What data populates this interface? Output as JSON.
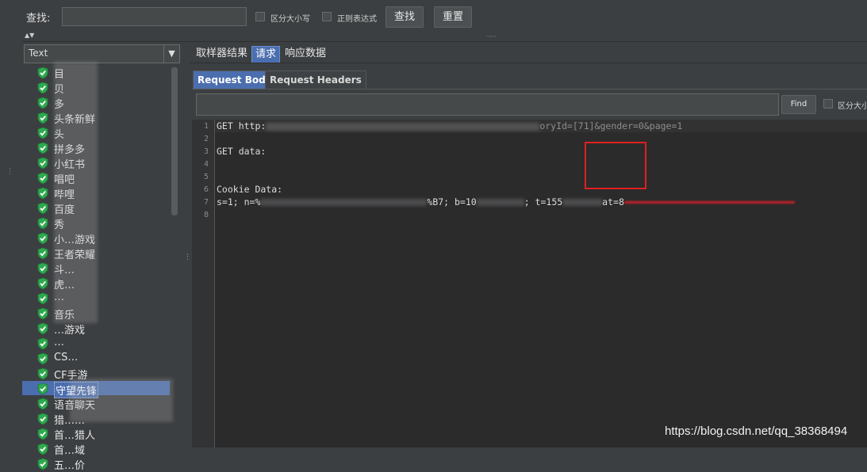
{
  "search": {
    "label": "查找:",
    "value": "",
    "case_label": "区分大小写",
    "regex_label": "正则表达式",
    "find_button": "查找",
    "reset_button": "重置"
  },
  "tree": {
    "combo_value": "Text",
    "items": [
      {
        "label": "目"
      },
      {
        "label": "贝"
      },
      {
        "label": "多"
      },
      {
        "label": "头条新鲜"
      },
      {
        "label": "头"
      },
      {
        "label": "拼多多"
      },
      {
        "label": "小红书"
      },
      {
        "label": "唱吧"
      },
      {
        "label": "哔哩"
      },
      {
        "label": "百度"
      },
      {
        "label": "秀"
      },
      {
        "label": "小…游戏"
      },
      {
        "label": "王者荣耀"
      },
      {
        "label": "斗…"
      },
      {
        "label": "虎…"
      },
      {
        "label": "…"
      },
      {
        "label": "音乐"
      },
      {
        "label": "…游戏"
      },
      {
        "label": "…"
      },
      {
        "label": "CS…"
      },
      {
        "label": "CF手游"
      },
      {
        "label": "守望先锋"
      },
      {
        "label": "语音聊天"
      },
      {
        "label": "猎……"
      },
      {
        "label": "首…猎人"
      },
      {
        "label": "首…域"
      },
      {
        "label": "五…价"
      }
    ],
    "selected_index": 21
  },
  "tabs": {
    "items": [
      "取样器结果",
      "请求",
      "响应数据"
    ],
    "active": 1
  },
  "subtabs": {
    "items": [
      "Request Body",
      "Request Headers"
    ],
    "active": 0
  },
  "finder": {
    "value": "",
    "button": "Find",
    "case_label": "区分大小"
  },
  "code": {
    "line_numbers": [
      "1",
      "2",
      "3",
      "4",
      "5",
      "6",
      "7",
      "8"
    ],
    "line1_method": "GET http:",
    "line1_tail": "oryId=[71]&gender=0&page=1",
    "line3": "GET data:",
    "line6": "Cookie Data:",
    "line7_a": "s=1; n=%",
    "line7_b": "%B7; b=10",
    "line7_c": "; t=155",
    "line7_d": "at=8"
  },
  "watermark": "https://blog.csdn.net/qq_38368494",
  "colors": {
    "accent": "#4b6eaf",
    "highlight_box": "#e02020",
    "check_icon": "#2fa84f"
  }
}
